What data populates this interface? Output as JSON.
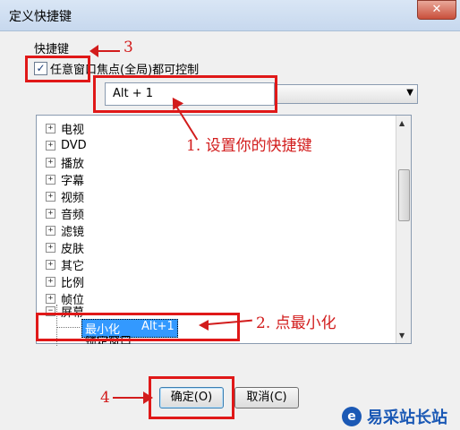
{
  "window": {
    "title": "定义快捷键",
    "close_glyph": "✕"
  },
  "group_label": "快捷键",
  "checkbox": {
    "label": "任意窗口焦点(全局)都可控制",
    "checked_glyph": "✓"
  },
  "hotkey_input": {
    "value": "Alt + 1"
  },
  "combo_arrow_glyph": "▼",
  "tree": {
    "items": [
      "电视",
      "DVD",
      "播放",
      "字幕",
      "视频",
      "音频",
      "滤镜",
      "皮肤",
      "其它",
      "比例",
      "帧位"
    ],
    "expanded_item": "屏幕",
    "selected_leaf": {
      "label": "最小化",
      "shortcut": "Alt+1"
    },
    "partial_leaf": "锁定窗口"
  },
  "buttons": {
    "ok": "确定(O)",
    "cancel": "取消(C)"
  },
  "annotations": {
    "step1": "1. 设置你的快捷键",
    "step2": "2. 点最小化",
    "step3": "3",
    "step4": "4"
  },
  "watermark": {
    "text": "易采站长站",
    "icon": "e"
  },
  "colors": {
    "annotation": "#d21c1c",
    "selection": "#3399ff"
  }
}
